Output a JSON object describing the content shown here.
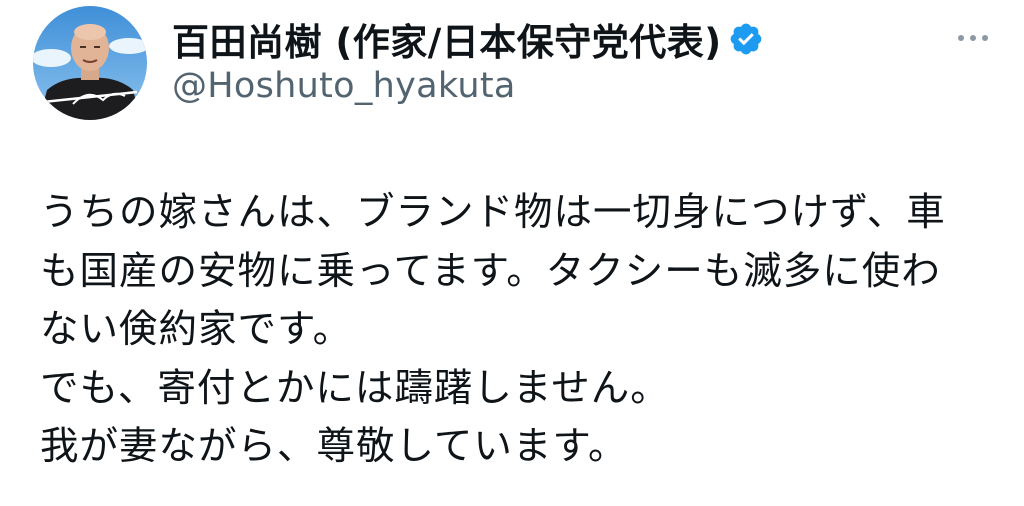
{
  "author": {
    "display_name": "百田尚樹 (作家/日本保守党代表)",
    "handle": "@Hoshuto_hyakuta",
    "verified": true,
    "avatar_signature": "百田尚樹"
  },
  "tweet": {
    "lines": [
      "うちの嫁さんは、ブランド物は一切身につけず、車",
      "も国産の安物に乗ってます。タクシーも滅多に使わ",
      "ない倹約家です。",
      "でも、寄付とかには躊躇しません。",
      "我が妻ながら、尊敬しています。"
    ]
  },
  "icons": {
    "verified": "verified-badge-icon",
    "more": "more-options-icon"
  },
  "colors": {
    "text": "#0f1419",
    "secondary": "#536471",
    "verified_blue": "#1d9bf0",
    "background": "#ffffff"
  }
}
